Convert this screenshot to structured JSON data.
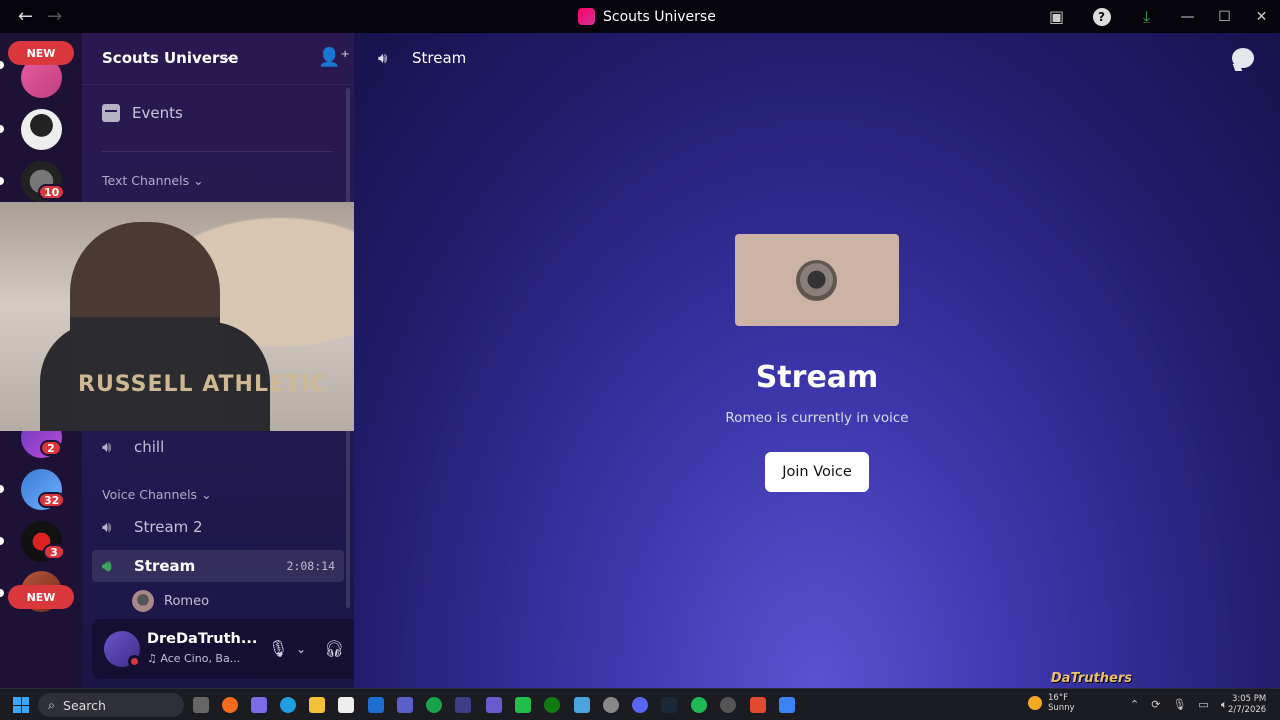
{
  "window": {
    "title": "Scouts Universe",
    "back_label": "←",
    "forward_label": "→",
    "help_label": "?",
    "minimize_label": "—",
    "maximize_label": "☐",
    "close_label": "✕"
  },
  "rail": {
    "new_label": "NEW",
    "badges": [
      "10",
      "2",
      "32",
      "3"
    ]
  },
  "server": {
    "name": "Scouts Universe",
    "events_label": "Events",
    "text_category": "Text Channels",
    "voice_category": "Voice Channels"
  },
  "channels": {
    "chill": "chill",
    "stream2": "Stream 2",
    "stream": "Stream",
    "stream_timer": "2:08:14",
    "member": "Romeo"
  },
  "user": {
    "name": "DreDaTruth...",
    "activity": "Ace Cino, Ba..."
  },
  "main": {
    "channel_name": "Stream",
    "title": "Stream",
    "subtitle": "Romeo is currently in voice",
    "join_label": "Join Voice"
  },
  "webcam": {
    "shirt_text": "RUSSELL ATHLETIC"
  },
  "watermark": "DaTruthers",
  "taskbar": {
    "search_label": "Search",
    "weather_temp": "16°F",
    "weather_desc": "Sunny",
    "time": "3:05 PM",
    "date": "2/7/2026"
  },
  "colors": {
    "accent_green": "#3ba55c",
    "badge_red": "#da373c",
    "main_bg": "#2b2585"
  },
  "icons": [
    "speaker-icon",
    "calendar-icon",
    "invite-icon",
    "microphone-icon",
    "headphones-icon",
    "gear-icon",
    "chat-icon"
  ]
}
